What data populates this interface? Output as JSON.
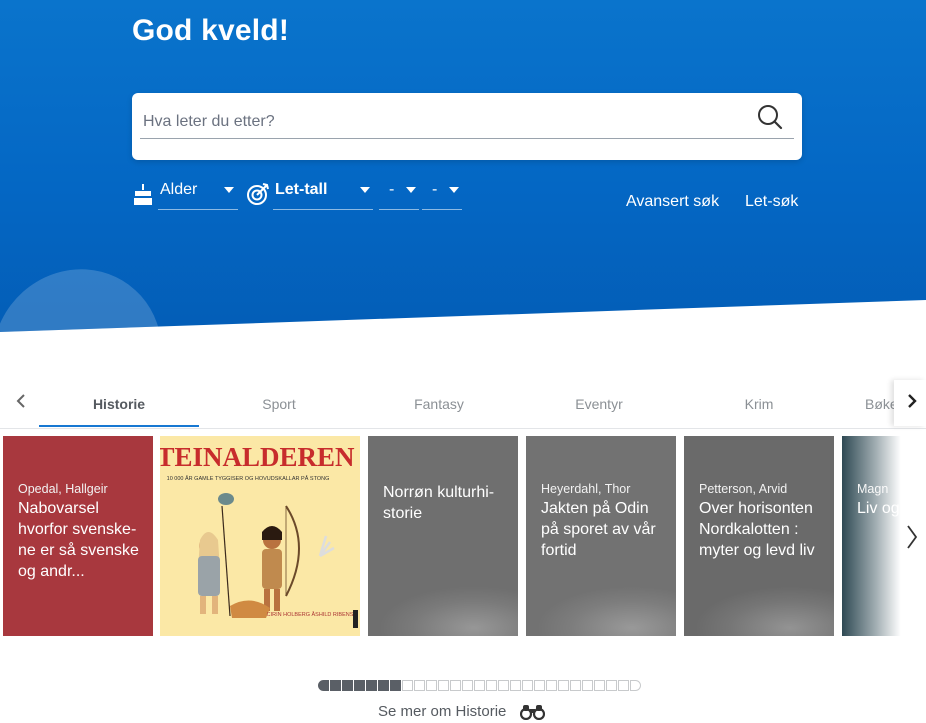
{
  "hero": {
    "greeting": "God kveld!",
    "search": {
      "placeholder": "Hva leter du etter?"
    },
    "filters": {
      "age_label": "Alder",
      "level_label": "Let-tall",
      "from_label": "-",
      "to_label": "-"
    },
    "links": {
      "advanced": "Avansert søk",
      "easy": "Let-søk"
    }
  },
  "tabs": {
    "items": [
      "Historie",
      "Sport",
      "Fantasy",
      "Eventyr",
      "Krim",
      "Bøker"
    ],
    "active": "Historie"
  },
  "books": [
    {
      "author": "Opedal, Hallgeir",
      "title": "Nabovarsel hvorfor svenske-ne er så svenske og andr...",
      "color": "#a8383e"
    },
    {
      "author": "",
      "title": "",
      "cover": {
        "heading": "STEINALDEREN",
        "sub": "10 000 ÅR GAMLE TYGGISER OG HOVUDSKALLAR PÅ STONG",
        "authors": "CIRIN HOLBERG ÅSHILD RIBENS",
        "bg": "#fbe8a6",
        "heading_color": "#c72c2c"
      }
    },
    {
      "author": "",
      "title": "Norrøn kulturhi-storie",
      "color": "#6f6f6f"
    },
    {
      "author": "Heyerdahl, Thor",
      "title": "Jakten på Odin på sporet av vår fortid",
      "color": "#727272"
    },
    {
      "author": "Petterson, Arvid",
      "title": "Over horisonten Nordkalotten : myter og levd liv",
      "color": "#6a6a6a"
    },
    {
      "author": "Magn",
      "title": "Liv og viking",
      "color": "#2f4a54"
    }
  ],
  "pager": {
    "total": 27,
    "current_filled": 7
  },
  "see_more": "Se mer om Historie",
  "colors": {
    "brand": "#0467c4",
    "accent_tab": "#1778d2"
  }
}
